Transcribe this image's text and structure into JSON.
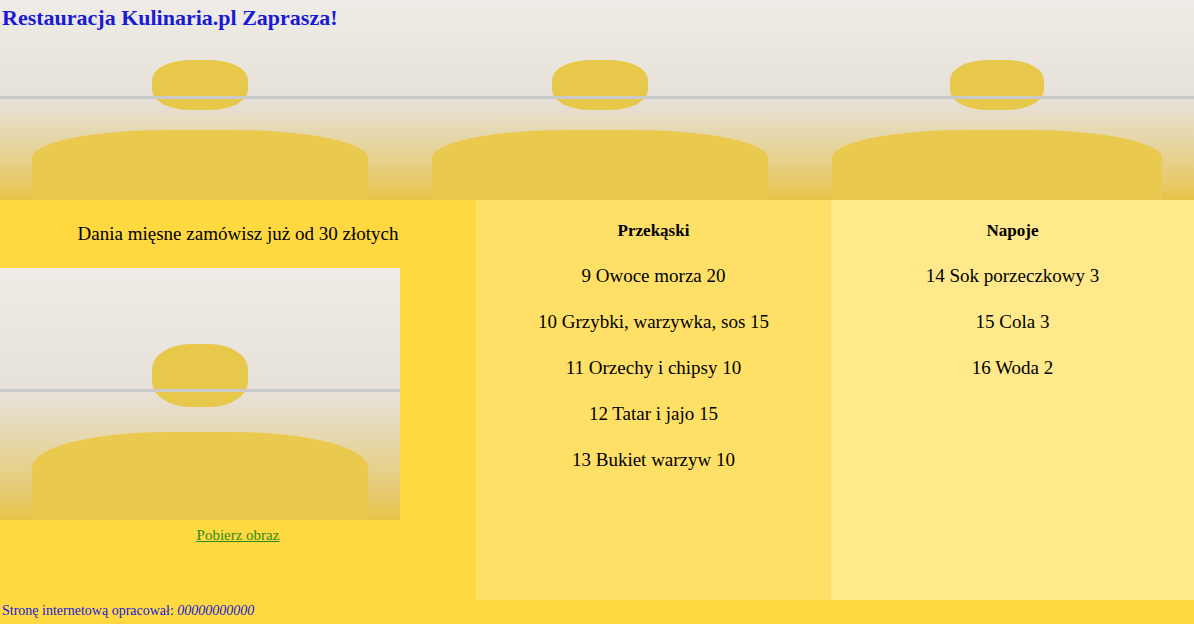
{
  "header": {
    "title": "Restauracja Kulinaria.pl Zaprasza!"
  },
  "left_column": {
    "text": "Dania mięsne zamówisz już od 30 złotych",
    "link": "Pobierz obraz"
  },
  "menus": [
    {
      "heading": "Przekąski",
      "items": [
        "9 Owoce morza 20",
        "10 Grzybki, warzywka, sos 15",
        "11 Orzechy i chipsy 10",
        "12 Tatar i jajo 15",
        "13 Bukiet warzyw 10"
      ]
    },
    {
      "heading": "Napoje",
      "items": [
        "14 Sok porzeczkowy 3",
        "15 Cola 3",
        "16 Woda 2"
      ]
    }
  ],
  "footer": {
    "label": "Stronę internetową opracował: ",
    "author": "00000000000"
  }
}
